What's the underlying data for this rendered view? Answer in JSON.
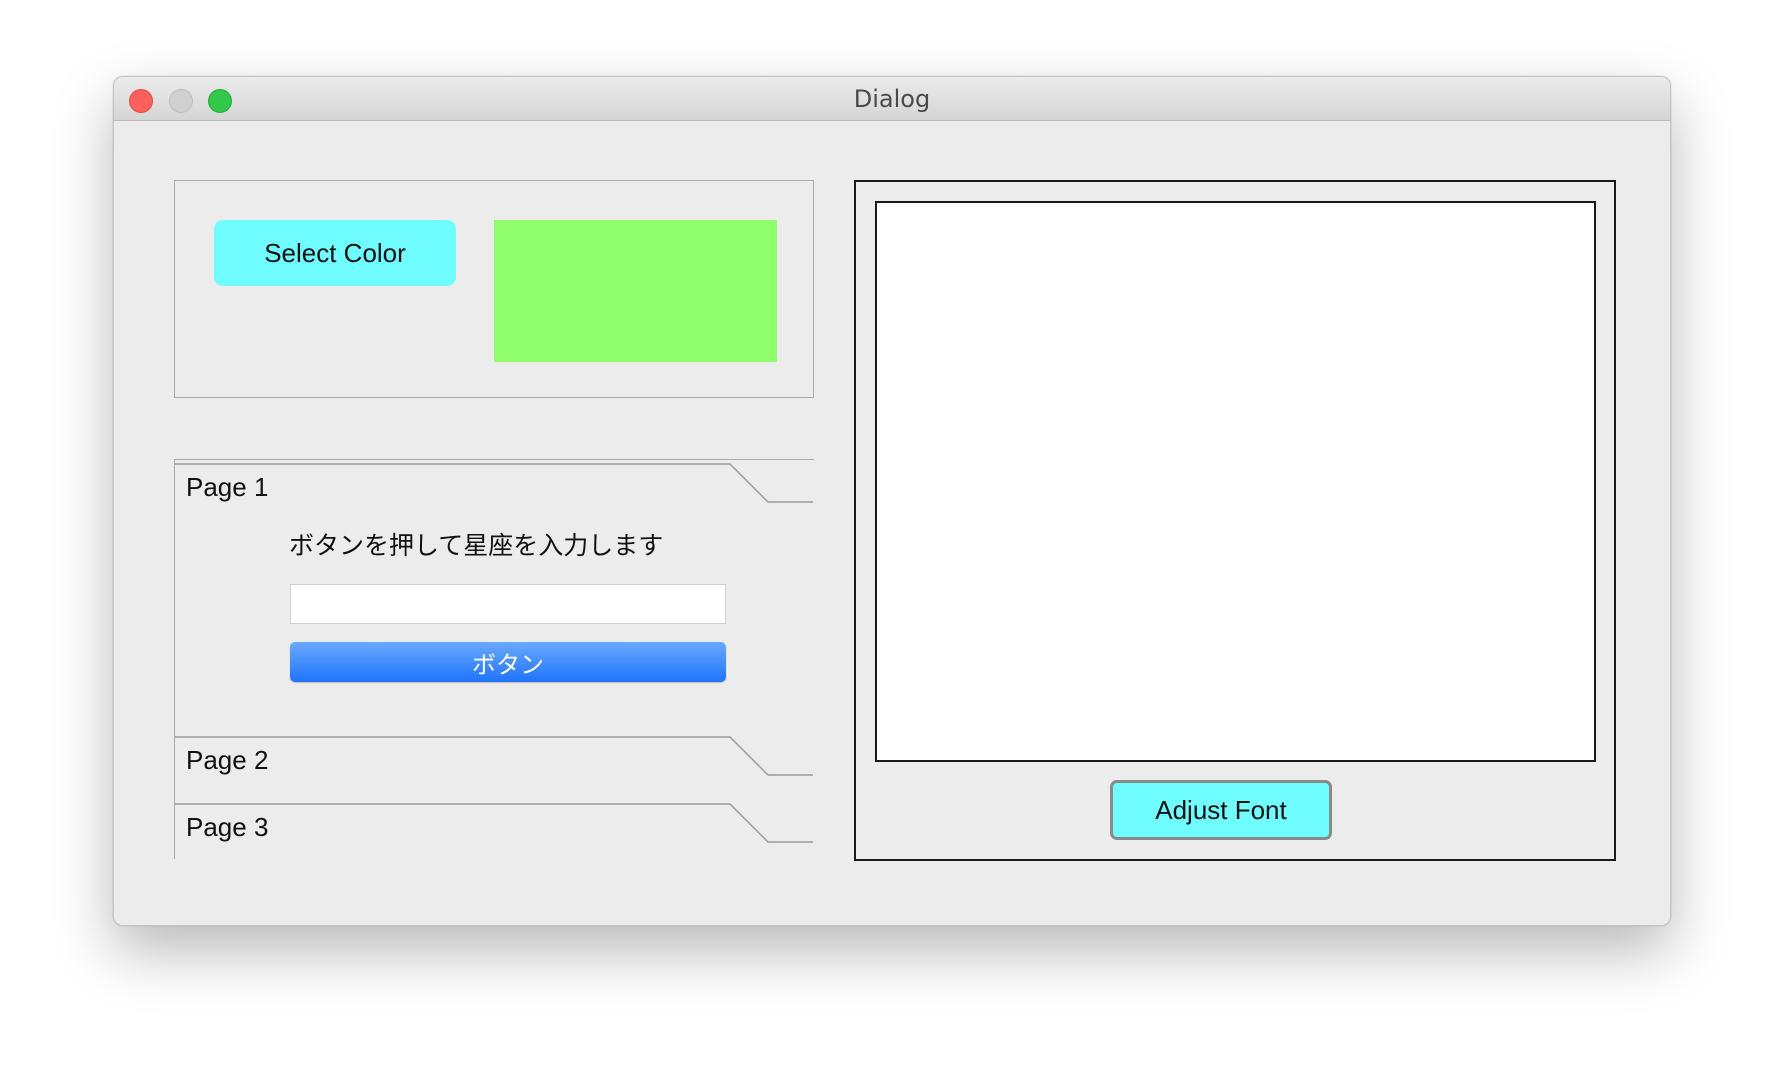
{
  "window": {
    "title": "Dialog"
  },
  "color_panel": {
    "select_color_label": "Select Color",
    "selected_color": "#90fe6c",
    "button_color": "#6ffdff"
  },
  "toolbox": {
    "pages": [
      {
        "label": "Page 1",
        "expanded": true
      },
      {
        "label": "Page 2",
        "expanded": false
      },
      {
        "label": "Page 3",
        "expanded": false
      }
    ],
    "page1": {
      "prompt": "ボタンを押して星座を入力します",
      "input_value": "",
      "button_label": "ボタン"
    }
  },
  "editor": {
    "text": "",
    "adjust_font_label": "Adjust Font"
  }
}
